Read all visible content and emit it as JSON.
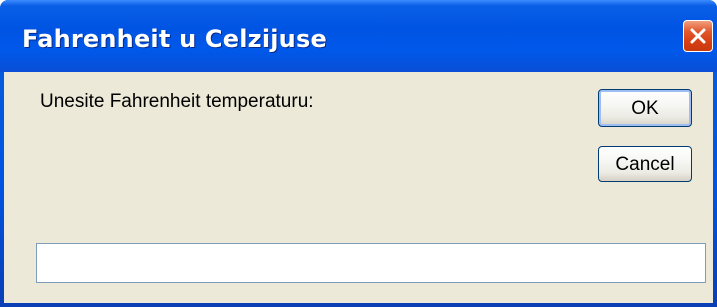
{
  "window": {
    "title": "Fahrenheit u Celzijuse",
    "close_icon": "close-icon"
  },
  "dialog": {
    "prompt": "Unesite Fahrenheit temperaturu:",
    "ok_label": "OK",
    "cancel_label": "Cancel",
    "input_value": ""
  },
  "colors": {
    "titlebar": "#0054e3",
    "client_bg": "#ece9d8",
    "close_button": "#e2572c",
    "button_border": "#003c74",
    "input_border": "#7f9db9"
  }
}
